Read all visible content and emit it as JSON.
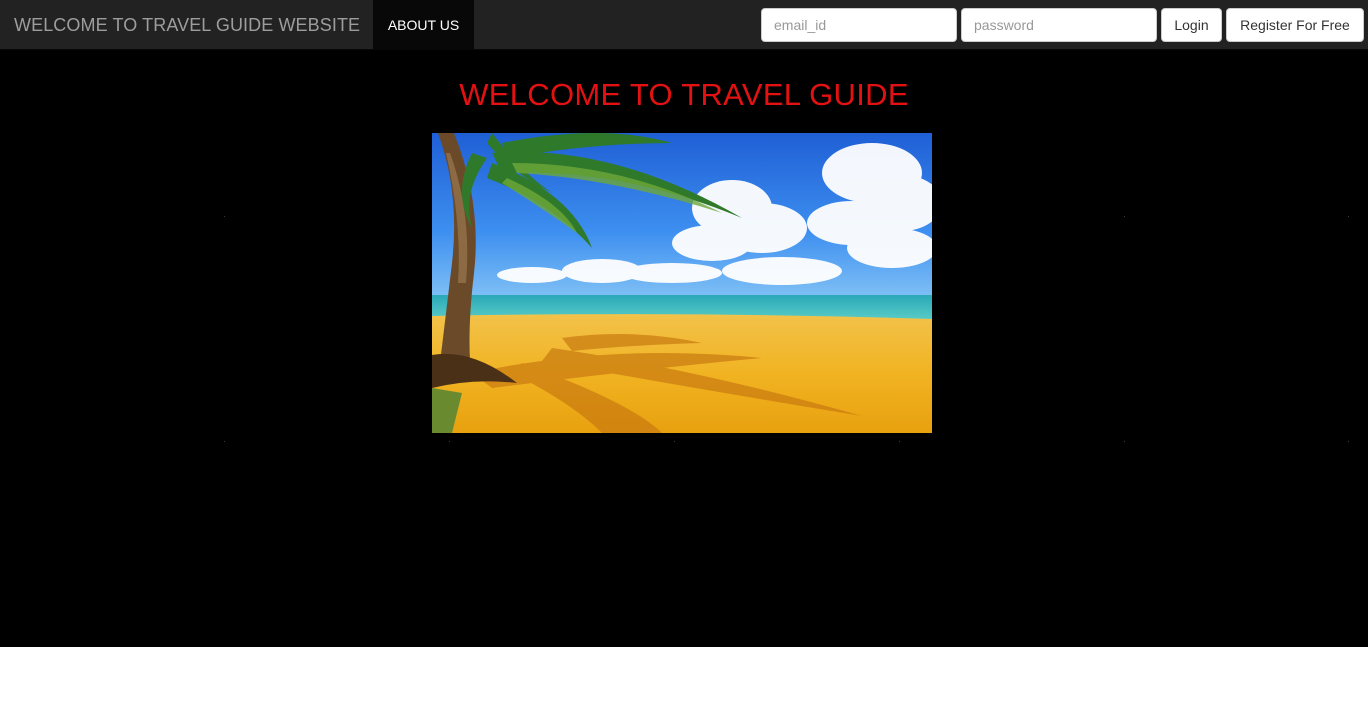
{
  "navbar": {
    "brand": "WELCOME TO TRAVEL GUIDE WEBSITE",
    "about_label": "ABOUT US",
    "background": "#222222"
  },
  "login": {
    "email_placeholder": "email_id",
    "password_placeholder": "password",
    "login_label": "Login",
    "register_label": "Register For Free"
  },
  "hero": {
    "title": "WELCOME TO TRAVEL GUIDE",
    "title_color": "#e31111",
    "image_icon": "tropical-beach-image"
  }
}
